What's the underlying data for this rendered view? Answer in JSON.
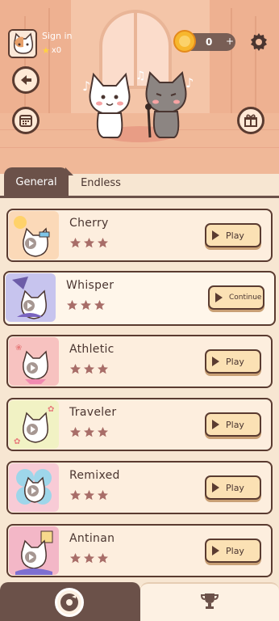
{
  "header": {
    "signin_label": "Sign in",
    "stars_count": "x0",
    "coins": "0",
    "coin_plus": "+"
  },
  "tabs": [
    {
      "label": "General",
      "active": true
    },
    {
      "label": "Endless",
      "active": false
    }
  ],
  "songs": [
    {
      "title": "Cherry",
      "stars": 3,
      "action": "Play",
      "thumb_color": "#fbd9b8"
    },
    {
      "title": "Whisper",
      "stars": 3,
      "action": "Continue",
      "thumb_color": "#c7c4ee"
    },
    {
      "title": "Athletic",
      "stars": 3,
      "action": "Play",
      "thumb_color": "#f7c2c0"
    },
    {
      "title": "Traveler",
      "stars": 3,
      "action": "Play",
      "thumb_color": "#f1f2c4"
    },
    {
      "title": "Remixed",
      "stars": 3,
      "action": "Play",
      "thumb_color": "#f8cbd6"
    },
    {
      "title": "Antinan",
      "stars": 3,
      "action": "Play",
      "thumb_color": "#f3b7c7"
    }
  ],
  "colors": {
    "dark_brown": "#5a3b30",
    "star_fill": "#a86d68",
    "accent_coin": "#f7b72e"
  },
  "icons": [
    "back-arrow-icon",
    "calendar-icon",
    "gift-icon",
    "gear-icon",
    "coin-icon",
    "music-disc-icon",
    "trophy-icon",
    "play-icon",
    "star-icon"
  ]
}
